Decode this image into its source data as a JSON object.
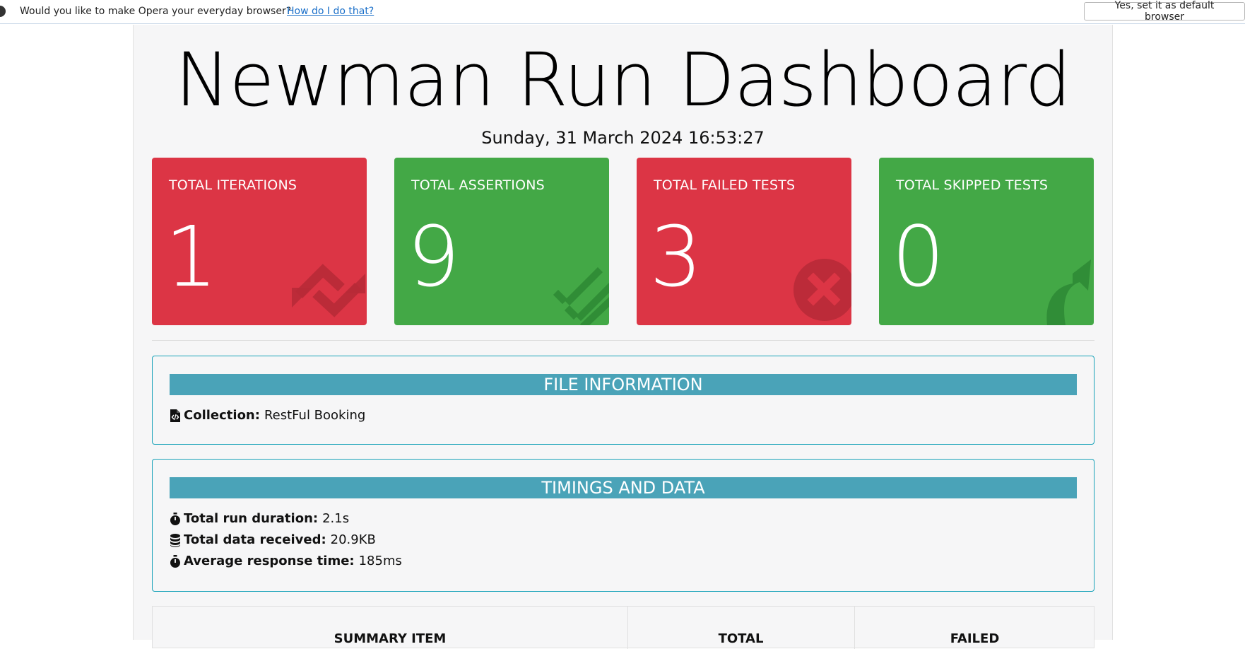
{
  "notification": {
    "message": "Would you like to make Opera your everyday browser?",
    "link": "How do I do that?",
    "button": "Yes, set it as default browser"
  },
  "dashboard": {
    "title": "Newman Run Dashboard",
    "date": "Sunday, 31 March 2024 16:53:27"
  },
  "cards": [
    {
      "label": "TOTAL ITERATIONS",
      "value": "1",
      "color": "#dc3545",
      "icon": "sync-icon"
    },
    {
      "label": "TOTAL ASSERTIONS",
      "value": "9",
      "color": "#43a846",
      "icon": "list-check-icon"
    },
    {
      "label": "TOTAL FAILED TESTS",
      "value": "3",
      "color": "#dc3545",
      "icon": "times-circle-icon"
    },
    {
      "label": "TOTAL SKIPPED TESTS",
      "value": "0",
      "color": "#43a846",
      "icon": "share-arrow-icon"
    }
  ],
  "file_info": {
    "header": "FILE INFORMATION",
    "collection_label": "Collection:",
    "collection_value": "RestFul Booking"
  },
  "timings": {
    "header": "TIMINGS AND DATA",
    "items": [
      {
        "label": "Total run duration:",
        "value": "2.1s",
        "icon": "stopwatch-icon"
      },
      {
        "label": "Total data received:",
        "value": "20.9KB",
        "icon": "database-icon"
      },
      {
        "label": "Average response time:",
        "value": "185ms",
        "icon": "stopwatch-icon"
      }
    ]
  },
  "summary_table": {
    "columns": [
      "SUMMARY ITEM",
      "TOTAL",
      "FAILED"
    ]
  }
}
